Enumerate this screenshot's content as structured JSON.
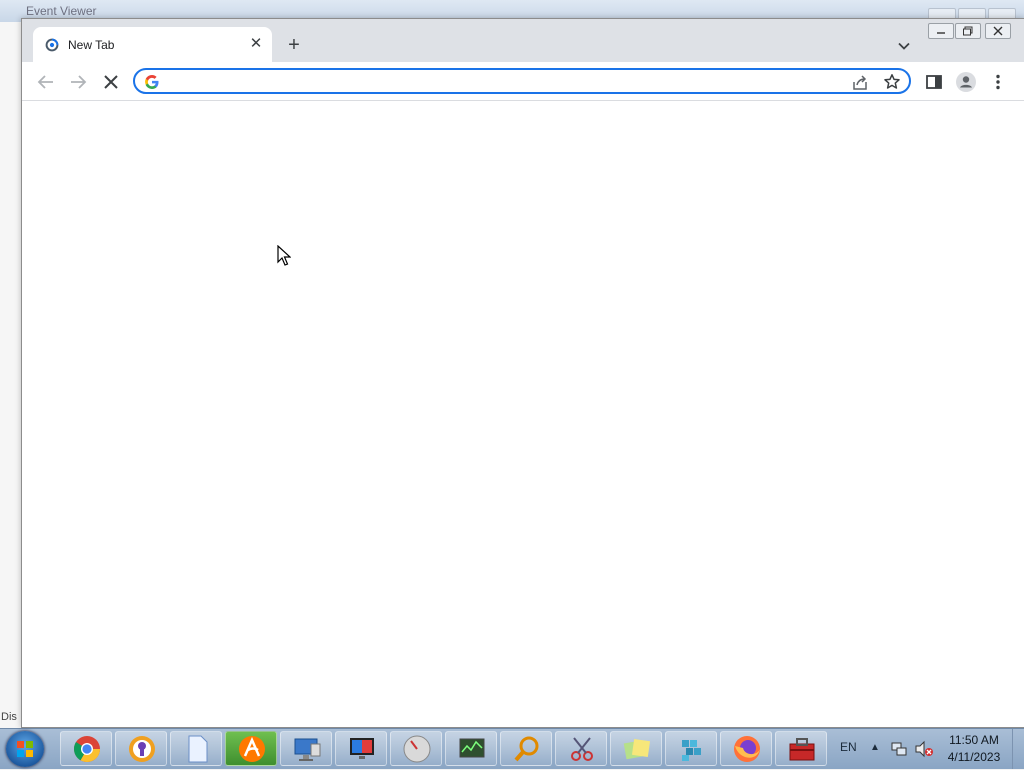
{
  "background_window": {
    "title": "Event Viewer",
    "status_fragment": "Dis"
  },
  "browser": {
    "tab": {
      "title": "New Tab",
      "favicon": "chrome-loading-icon"
    },
    "toolbar": {
      "back_icon": "arrow-left-icon",
      "forward_icon": "arrow-right-icon",
      "stop_icon": "close-icon",
      "omnibox": {
        "value": "",
        "placeholder": "",
        "search_engine_icon": "google-g-icon"
      },
      "share_icon": "share-icon",
      "bookmark_icon": "star-icon",
      "side_panel_icon": "side-panel-icon",
      "profile_icon": "person-icon",
      "menu_icon": "more-vert-icon"
    },
    "accent_color": "#1a73e8"
  },
  "taskbar": {
    "apps": [
      {
        "name": "chrome"
      },
      {
        "name": "avast-secureline"
      },
      {
        "name": "blank-document"
      },
      {
        "name": "avast"
      },
      {
        "name": "remote-desktop"
      },
      {
        "name": "display-monitor"
      },
      {
        "name": "disk-utility"
      },
      {
        "name": "system-monitor"
      },
      {
        "name": "search-tool"
      },
      {
        "name": "snipping-tool"
      },
      {
        "name": "sticky-notes"
      },
      {
        "name": "registry-editor"
      },
      {
        "name": "firefox"
      },
      {
        "name": "toolbox"
      }
    ],
    "tray": {
      "language": "EN",
      "time": "11:50 AM",
      "date": "4/11/2023"
    }
  }
}
